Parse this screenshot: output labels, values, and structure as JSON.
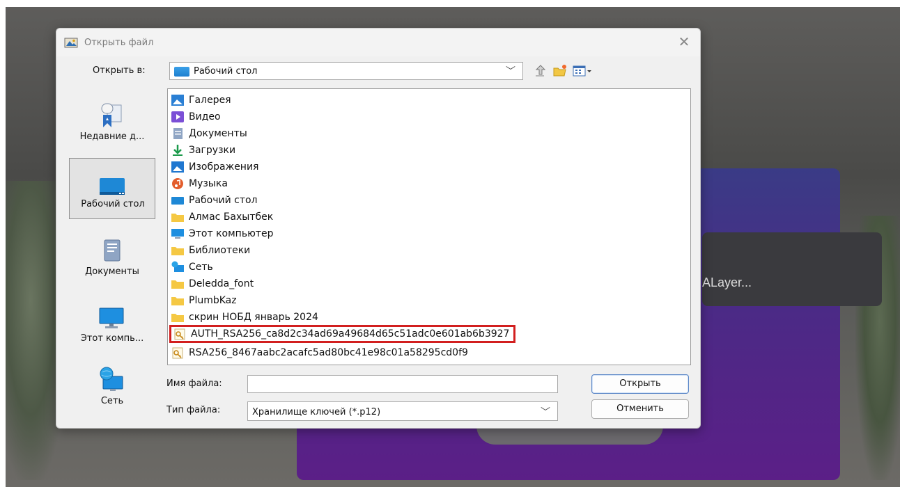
{
  "background": {
    "banner_text": "ALayer..."
  },
  "dialog": {
    "title": "Открыть файл",
    "close_glyph": "✕",
    "look_in_label": "Открыть в:",
    "look_in_value": "Рабочий стол",
    "toolbar_icons": [
      "up-folder-icon",
      "new-folder-icon",
      "view-menu-icon"
    ]
  },
  "sidebar": {
    "items": [
      {
        "label": "Недавние д...",
        "icon": "recent-documents-icon",
        "selected": false
      },
      {
        "label": "Рабочий стол",
        "icon": "desktop-icon",
        "selected": true
      },
      {
        "label": "Документы",
        "icon": "documents-icon",
        "selected": false
      },
      {
        "label": "Этот компь...",
        "icon": "this-pc-icon",
        "selected": false
      },
      {
        "label": "Сеть",
        "icon": "network-icon",
        "selected": false
      }
    ]
  },
  "files": {
    "items": [
      {
        "name": "Галерея",
        "icon": "gallery-icon"
      },
      {
        "name": "Видео",
        "icon": "video-icon"
      },
      {
        "name": "Документы",
        "icon": "documents-icon"
      },
      {
        "name": "Загрузки",
        "icon": "downloads-icon"
      },
      {
        "name": "Изображения",
        "icon": "pictures-icon"
      },
      {
        "name": "Музыка",
        "icon": "music-icon"
      },
      {
        "name": "Рабочий стол",
        "icon": "desktop-icon"
      },
      {
        "name": "Алмас Бахытбек",
        "icon": "folder-icon"
      },
      {
        "name": "Этот компьютер",
        "icon": "this-pc-icon"
      },
      {
        "name": "Библиотеки",
        "icon": "folder-icon"
      },
      {
        "name": "Сеть",
        "icon": "network-icon"
      },
      {
        "name": "Deledda_font",
        "icon": "folder-icon"
      },
      {
        "name": "PlumbKaz",
        "icon": "folder-icon"
      },
      {
        "name": "скрин НОБД январь 2024",
        "icon": "folder-icon"
      },
      {
        "name": "AUTH_RSA256_ca8d2c34ad69a49684d65c51adc0e601ab6b3927",
        "icon": "key-file-icon",
        "highlighted": true
      },
      {
        "name": "RSA256_8467aabc2acafc5ad80bc41e98c01a58295cd0f9",
        "icon": "key-file-icon"
      }
    ]
  },
  "form": {
    "file_name_label": "Имя файла:",
    "file_name_value": "",
    "file_type_label": "Тип файла:",
    "file_type_value": "Хранилище ключей (*.p12)",
    "open_button": "Открыть",
    "cancel_button": "Отменить"
  },
  "colors": {
    "highlight_border": "#d21f1f",
    "primary_border": "#5a86c7"
  }
}
